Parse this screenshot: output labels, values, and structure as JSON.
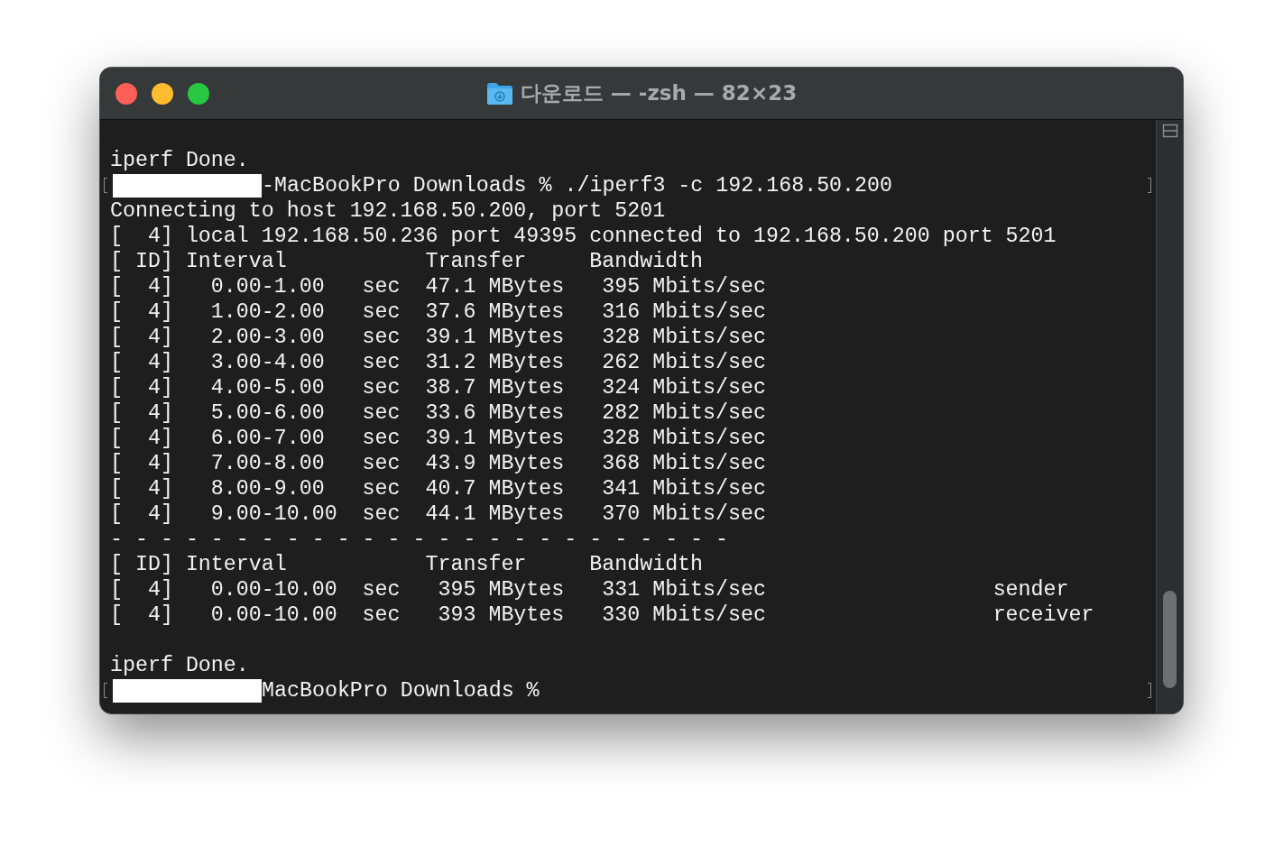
{
  "window": {
    "title": "다운로드 — -zsh — 82×23"
  },
  "lines": [
    {
      "kind": "blank"
    },
    {
      "kind": "text",
      "text": "iperf Done."
    },
    {
      "kind": "prompt",
      "redacted": true,
      "text": "-MacBookPro Downloads % ./iperf3 -c 192.168.50.200"
    },
    {
      "kind": "text",
      "text": "Connecting to host 192.168.50.200, port 5201"
    },
    {
      "kind": "text",
      "text": "[  4] local 192.168.50.236 port 49395 connected to 192.168.50.200 port 5201"
    },
    {
      "kind": "text",
      "text": "[ ID] Interval           Transfer     Bandwidth"
    },
    {
      "kind": "text",
      "text": "[  4]   0.00-1.00   sec  47.1 MBytes   395 Mbits/sec"
    },
    {
      "kind": "text",
      "text": "[  4]   1.00-2.00   sec  37.6 MBytes   316 Mbits/sec"
    },
    {
      "kind": "text",
      "text": "[  4]   2.00-3.00   sec  39.1 MBytes   328 Mbits/sec"
    },
    {
      "kind": "text",
      "text": "[  4]   3.00-4.00   sec  31.2 MBytes   262 Mbits/sec"
    },
    {
      "kind": "text",
      "text": "[  4]   4.00-5.00   sec  38.7 MBytes   324 Mbits/sec"
    },
    {
      "kind": "text",
      "text": "[  4]   5.00-6.00   sec  33.6 MBytes   282 Mbits/sec"
    },
    {
      "kind": "text",
      "text": "[  4]   6.00-7.00   sec  39.1 MBytes   328 Mbits/sec"
    },
    {
      "kind": "text",
      "text": "[  4]   7.00-8.00   sec  43.9 MBytes   368 Mbits/sec"
    },
    {
      "kind": "text",
      "text": "[  4]   8.00-9.00   sec  40.7 MBytes   341 Mbits/sec"
    },
    {
      "kind": "text",
      "text": "[  4]   9.00-10.00  sec  44.1 MBytes   370 Mbits/sec"
    },
    {
      "kind": "text",
      "text": "- - - - - - - - - - - - - - - - - - - - - - - - -"
    },
    {
      "kind": "text",
      "text": "[ ID] Interval           Transfer     Bandwidth"
    },
    {
      "kind": "text",
      "text": "[  4]   0.00-10.00  sec   395 MBytes   331 Mbits/sec                  sender"
    },
    {
      "kind": "text",
      "text": "[  4]   0.00-10.00  sec   393 MBytes   330 Mbits/sec                  receiver"
    },
    {
      "kind": "blank"
    },
    {
      "kind": "text",
      "text": "iperf Done."
    },
    {
      "kind": "prompt",
      "redacted": true,
      "text": "MacBookPro Downloads %"
    }
  ]
}
